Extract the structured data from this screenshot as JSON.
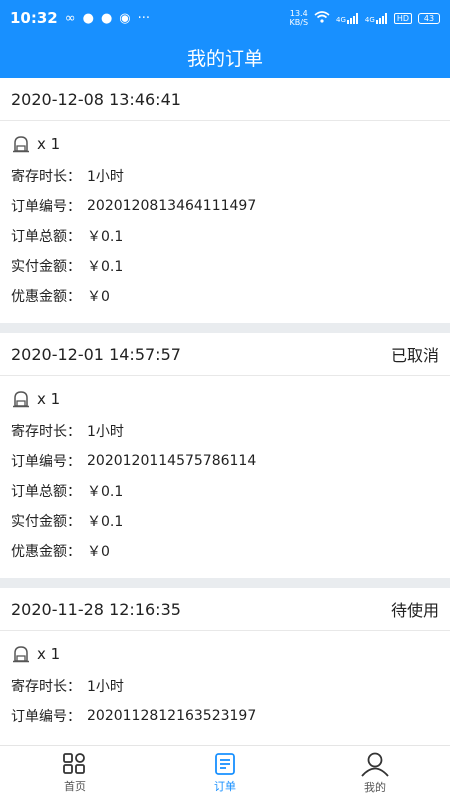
{
  "status_bar": {
    "time": "10:32",
    "speed_top": "13.4",
    "speed_bottom": "KB/S",
    "signal1": "4G",
    "signal2": "4G",
    "hd": "HD",
    "battery": "43"
  },
  "header": {
    "title": "我的订单"
  },
  "orders": [
    {
      "datetime": "2020-12-08 13:46:41",
      "status": "",
      "item_qty": "x 1",
      "duration_label": "寄存时长：",
      "duration": "1小时",
      "number_label": "订单编号：",
      "number": "2020120813464111497",
      "total_label": "订单总额：",
      "total": "￥0.1",
      "paid_label": "实付金额：",
      "paid": "￥0.1",
      "discount_label": "优惠金额：",
      "discount": "￥0"
    },
    {
      "datetime": "2020-12-01 14:57:57",
      "status": "已取消",
      "item_qty": "x 1",
      "duration_label": "寄存时长：",
      "duration": "1小时",
      "number_label": "订单编号：",
      "number": "2020120114575786114",
      "total_label": "订单总额：",
      "total": "￥0.1",
      "paid_label": "实付金额：",
      "paid": "￥0.1",
      "discount_label": "优惠金额：",
      "discount": "￥0"
    },
    {
      "datetime": "2020-11-28 12:16:35",
      "status": "待使用",
      "item_qty": "x 1",
      "duration_label": "寄存时长：",
      "duration": "1小时",
      "number_label": "订单编号：",
      "number": "2020112812163523197"
    }
  ],
  "tabbar": {
    "home": "首页",
    "orders": "订单",
    "mine": "我的"
  },
  "colors": {
    "primary": "#1890ff",
    "separator": "#e9ecef"
  },
  "icons": [
    "backpack-icon",
    "home-grid-icon",
    "order-list-icon",
    "user-icon"
  ]
}
